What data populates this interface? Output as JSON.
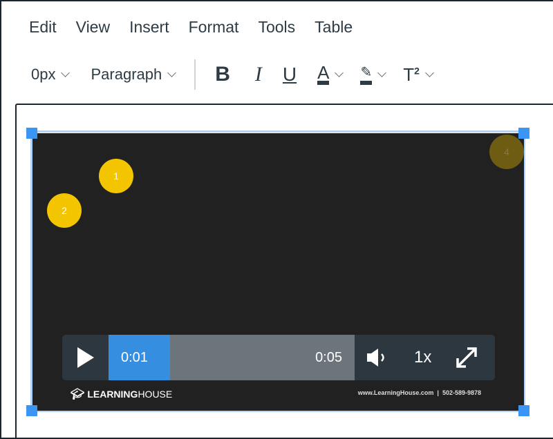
{
  "menu": {
    "items": [
      "Edit",
      "View",
      "Insert",
      "Format",
      "Tools",
      "Table"
    ]
  },
  "toolbar": {
    "font_size": "0px",
    "block_format": "Paragraph",
    "bold": "B",
    "italic": "I",
    "underline": "U",
    "text_color": "A",
    "superscript": "T",
    "superscript_mark": "2"
  },
  "video": {
    "markers": [
      "1",
      "2",
      "4"
    ],
    "current_time": "0:01",
    "duration": "0:05",
    "speed": "1x",
    "progress_fraction": 0.2,
    "logo_text_bold": "LEARNING",
    "logo_text": "HOUSE",
    "contact": "www.LearningHouse.com  |  502-589-9878"
  },
  "colors": {
    "selection": "#aed3fb",
    "handle": "#3a95f5",
    "progress": "#358ee0",
    "marker": "#f2c500"
  }
}
